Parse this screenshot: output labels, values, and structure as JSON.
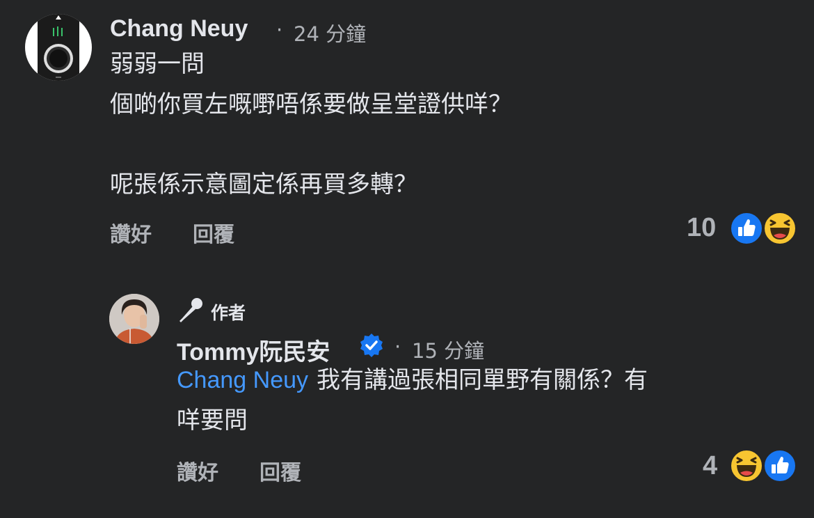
{
  "comment": {
    "author": "Chang Neuy",
    "separator": "·",
    "time": "24 分鐘",
    "lines": [
      "弱弱一問",
      "個啲你買左嘅嘢唔係要做呈堂證供咩？",
      "呢張係示意圖定係再買多轉？"
    ],
    "like_label": "讚好",
    "reply_label": "回覆",
    "reaction_count": "10",
    "reactions": [
      "like-icon",
      "haha-icon"
    ]
  },
  "reply": {
    "author_badge": "作者",
    "author": "Tommy阮民安",
    "separator": "·",
    "time": "15 分鐘",
    "mention": "Chang Neuy",
    "text_line1": "我有講過張相同單野有關係？有",
    "text_line2": "咩要問",
    "like_label": "讚好",
    "reply_label": "回覆",
    "reaction_count": "4",
    "reactions": [
      "haha-icon",
      "like-icon"
    ]
  },
  "colors": {
    "background": "#242526",
    "primary_text": "#e4e6eb",
    "secondary_text": "#b0b3b8",
    "link": "#4599ff",
    "like_blue": "#1877f2",
    "verified_blue": "#1877f2",
    "haha_yellow": "#f7c531"
  }
}
